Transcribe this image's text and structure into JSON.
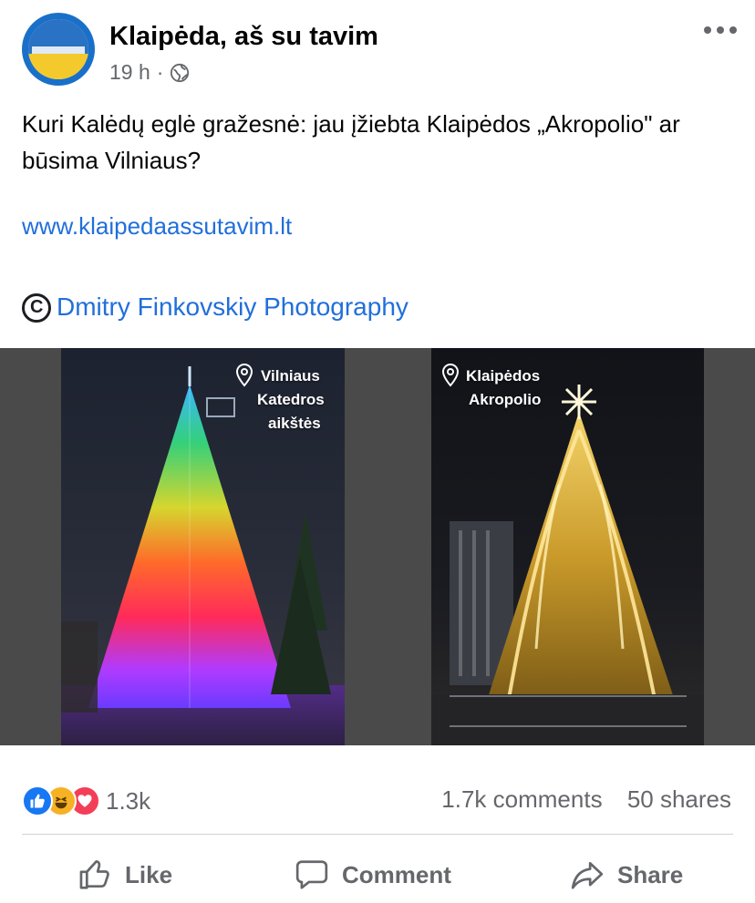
{
  "post": {
    "page_name": "Klaipėda, aš su tavim",
    "time": "19 h",
    "separator": "·",
    "text": "Kuri Kalėdų eglė gražesnė: jau įžiebta Klaipėdos „Akropolio\" ar būsima Vilniaus?",
    "link": "www.klaipedaassutavim.lt",
    "credit": "Dmitry Finkovskiy Photography"
  },
  "image": {
    "left_caption": [
      "Vilniaus",
      "Katedros",
      "aikštės"
    ],
    "right_caption": [
      "Klaipėdos",
      "Akropolio"
    ]
  },
  "reactions": {
    "types": [
      "like-icon",
      "haha-icon",
      "love-icon"
    ],
    "count": "1.3k"
  },
  "stats": {
    "comments": "1.7k comments",
    "shares": "50 shares"
  },
  "actions": {
    "like": "Like",
    "comment": "Comment",
    "share": "Share"
  },
  "colors": {
    "link": "#216fdb",
    "secondary_text": "#65676b",
    "like": "#1877f2",
    "haha": "#f7b125",
    "love": "#f33e58"
  }
}
